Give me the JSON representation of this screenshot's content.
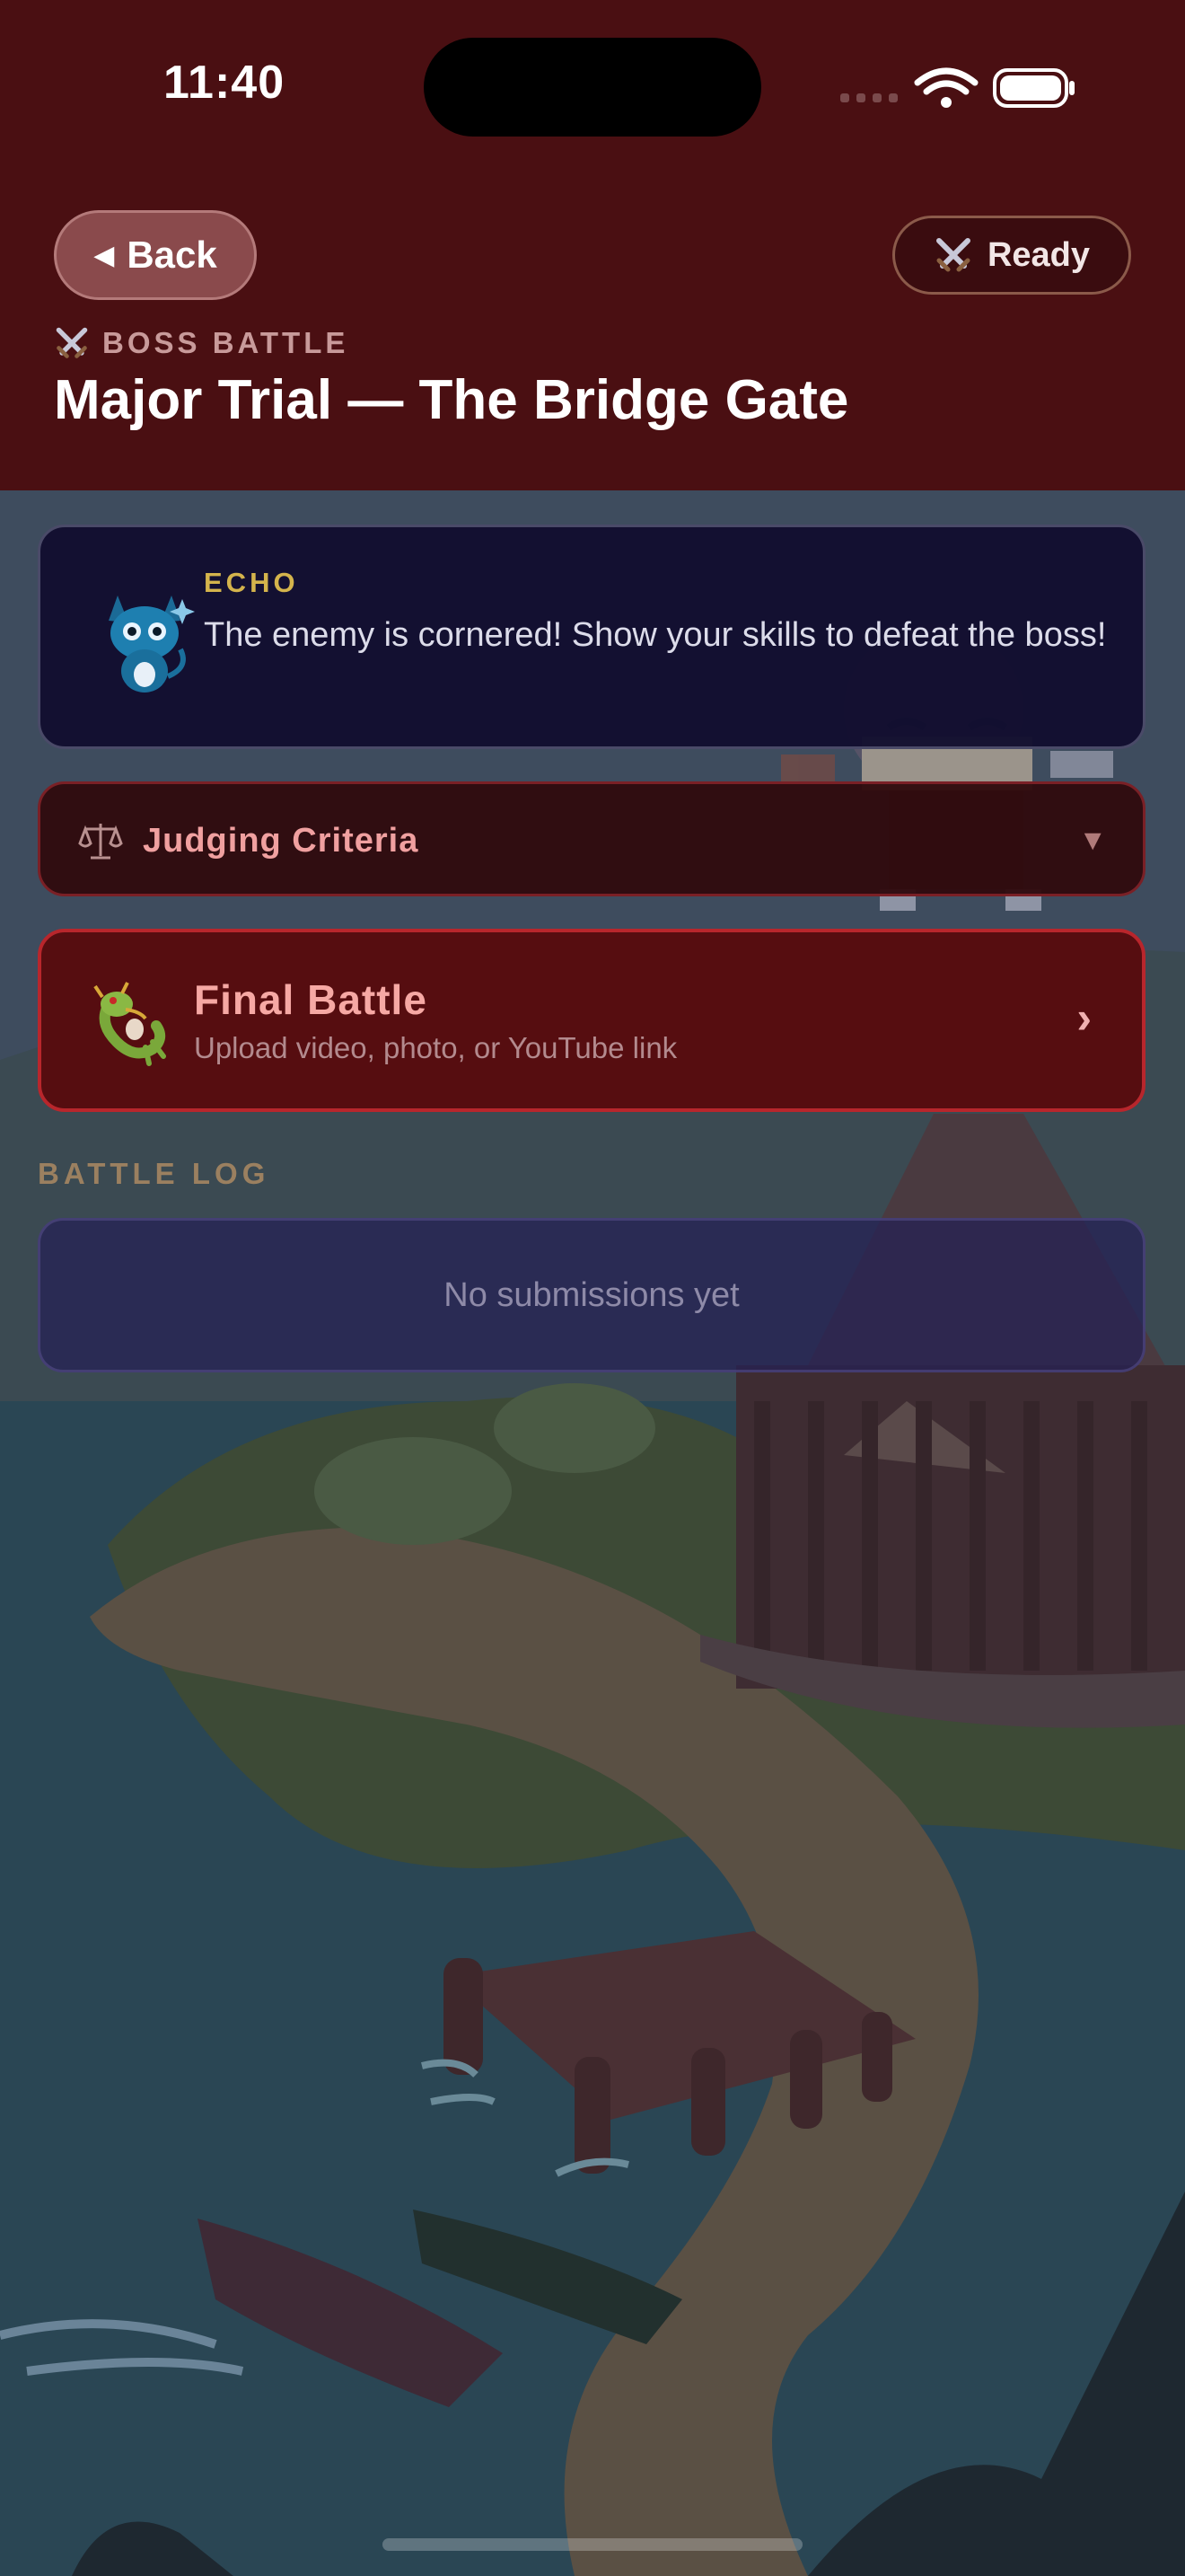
{
  "status_bar": {
    "time": "11:40"
  },
  "header": {
    "back_label": "Back",
    "ready_label": "Ready",
    "eyebrow": "BOSS BATTLE",
    "title": "Major Trial — The Bridge Gate"
  },
  "echo": {
    "name": "ECHO",
    "message": "The enemy is cornered! Show your skills to defeat the boss!"
  },
  "criteria": {
    "label": "Judging Criteria"
  },
  "final_battle": {
    "title": "Final Battle",
    "subtitle": "Upload video, photo, or YouTube link"
  },
  "battle_log": {
    "label": "BATTLE LOG",
    "empty_text": "No submissions yet"
  },
  "colors": {
    "header_bg": "#4a0f12",
    "accent_red": "#b8262c",
    "echo_gold": "#d4b44c"
  },
  "icons": [
    "crossed-swords-icon",
    "back-triangle-icon",
    "scales-icon",
    "chevron-down-icon",
    "chevron-right-icon",
    "dragon-icon",
    "wifi-icon",
    "battery-icon",
    "cellular-icon"
  ]
}
